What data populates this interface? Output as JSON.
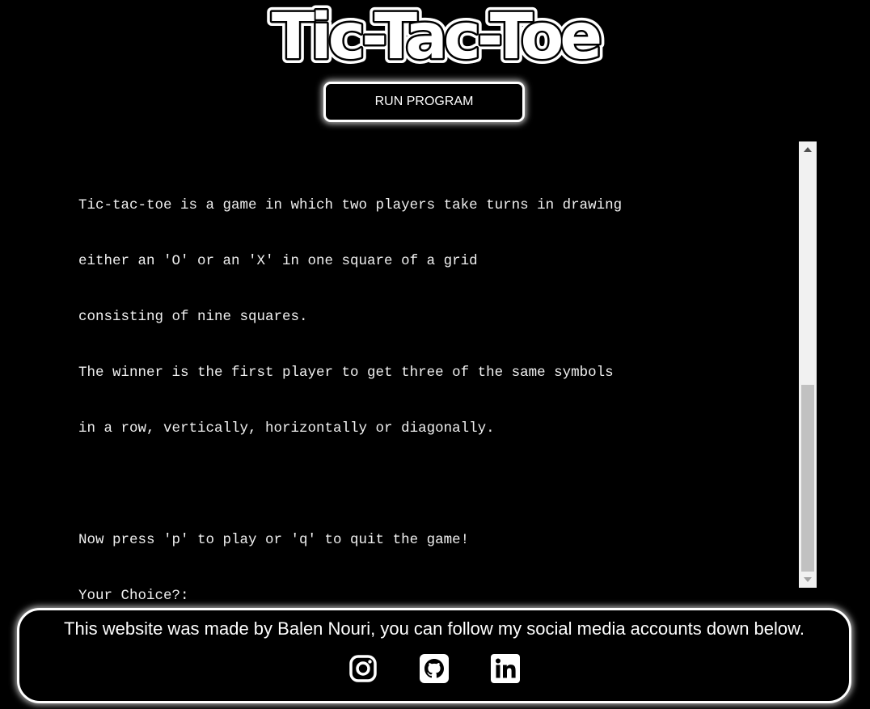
{
  "header": {
    "title": "Tic-Tac-Toe"
  },
  "controls": {
    "run_button_label": "RUN PROGRAM"
  },
  "terminal": {
    "lines": [
      "Tic-tac-toe is a game in which two players take turns in drawing",
      "either an 'O' or an 'X' in one square of a grid",
      "consisting of nine squares.",
      "The winner is the first player to get three of the same symbols",
      "in a row, vertically, horizontally or diagonally.",
      "",
      "Now press 'p' to play or 'q' to quit the game!",
      "Your Choice?:"
    ],
    "scroll_position": 1.0
  },
  "footer": {
    "text": "This website was made by Balen Nouri, you can follow my social media accounts down below.",
    "social_links": [
      {
        "icon": "instagram-icon"
      },
      {
        "icon": "github-icon"
      },
      {
        "icon": "linkedin-icon"
      }
    ]
  },
  "colors": {
    "background": "#000000",
    "text": "#ffffff",
    "terminal_text": "#f0f0f0",
    "scrollbar_track": "#f1f1f1",
    "scrollbar_thumb": "#c1c1c1"
  }
}
